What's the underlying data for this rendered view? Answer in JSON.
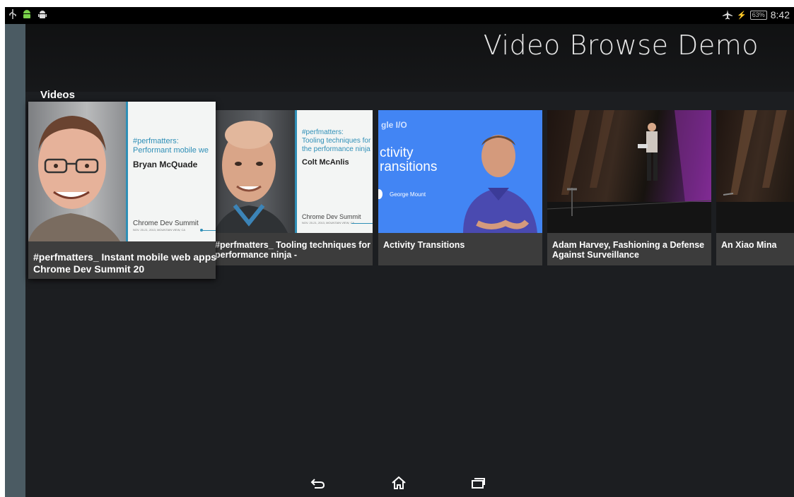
{
  "status": {
    "left_icons": [
      "usb-icon",
      "android-green-icon",
      "android-debug-icon"
    ],
    "battery": "63%",
    "time": "8:42"
  },
  "app": {
    "title": "Video Browse Demo"
  },
  "row": {
    "header": "Videos"
  },
  "cards": [
    {
      "title_line1": "#perfmatters_ Instant mobile web apps -",
      "title_line2": "Chrome Dev Summit 20",
      "hashtag": "#perfmatters:",
      "subtitle": "Performant mobile we",
      "speaker": "Bryan McQuade",
      "event": "Chrome Dev Summit",
      "event_small": "NOV. 20-21, 2013, MOUNTAIN VIEW, CA"
    },
    {
      "title_line1": "#perfmatters_ Tooling techniques for the",
      "title_line2": "performance ninja -",
      "hashtag": "#perfmatters:",
      "subtitle1": "Tooling techniques for",
      "subtitle2": "the performance ninja",
      "speaker": "Colt McAnlis",
      "event": "Chrome Dev Summit",
      "event_small": "NOV. 20-21, 2013, MOUNTAIN VIEW, CA"
    },
    {
      "title_line1": "Activity Transitions",
      "title_line2": "",
      "logo": "gle I/O",
      "slide1": "ctivity",
      "slide2": "ransitions",
      "speaker": "George Mount"
    },
    {
      "title_line1": "Adam Harvey, Fashioning a Defense",
      "title_line2": "Against Surveillance"
    },
    {
      "title_line1": "An Xiao Mina",
      "title_line2": ""
    }
  ],
  "colors": {
    "background": "#1c1e21",
    "headers_strip": "#4b5b63",
    "card_info": "#3c3c3c",
    "accent_blue": "#4285f4",
    "slide_blue": "#2f8fb7"
  },
  "nav": {
    "back": "back-icon",
    "home": "home-icon",
    "recents": "recents-icon"
  }
}
